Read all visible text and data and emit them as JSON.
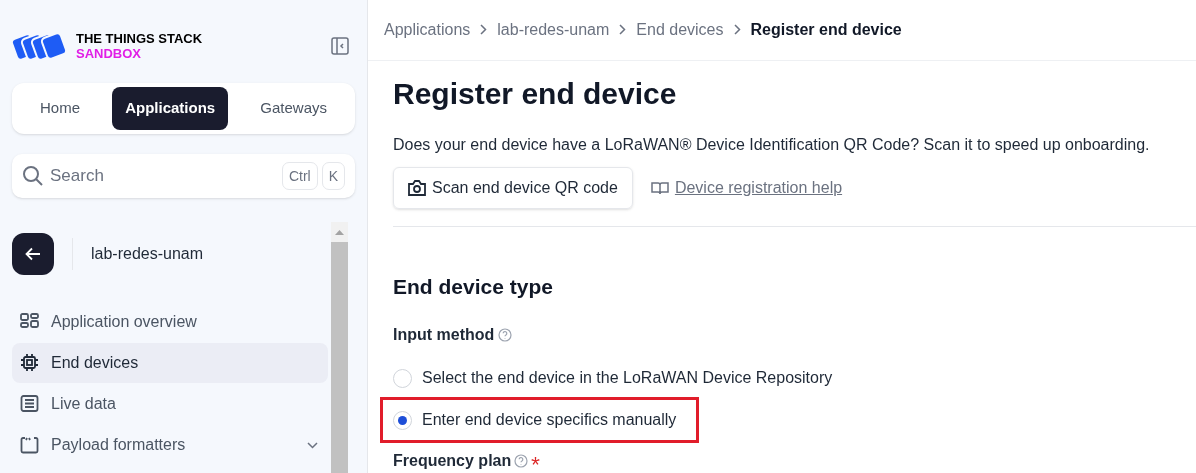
{
  "logo": {
    "line1": "THE THINGS STACK",
    "line2": "SANDBOX"
  },
  "nav_tabs": [
    {
      "label": "Home",
      "selected": false
    },
    {
      "label": "Applications",
      "selected": true
    },
    {
      "label": "Gateways",
      "selected": false
    }
  ],
  "search": {
    "placeholder": "Search",
    "shortcut": [
      "Ctrl",
      "K"
    ]
  },
  "application": {
    "name": "lab-redes-unam"
  },
  "sidebar_items": [
    {
      "label": "Application overview",
      "selected": false
    },
    {
      "label": "End devices",
      "selected": true
    },
    {
      "label": "Live data",
      "selected": false
    },
    {
      "label": "Payload formatters",
      "selected": false,
      "expanded": false
    }
  ],
  "breadcrumb": [
    "Applications",
    "lab-redes-unam",
    "End devices",
    "Register end device"
  ],
  "page_title": "Register end device",
  "qr_prompt": "Does your end device have a LoRaWAN® Device Identification QR Code? Scan it to speed up onboarding.",
  "scan_button": "Scan end device QR code",
  "help_link": "Device registration help",
  "section_title": "End device type",
  "input_method": {
    "label": "Input method",
    "options": [
      {
        "label": "Select the end device in the LoRaWAN Device Repository",
        "selected": false,
        "highlighted": false
      },
      {
        "label": "Enter end device specifics manually",
        "selected": true,
        "highlighted": true
      }
    ]
  },
  "frequency_plan": {
    "label": "Frequency plan",
    "required": true
  }
}
